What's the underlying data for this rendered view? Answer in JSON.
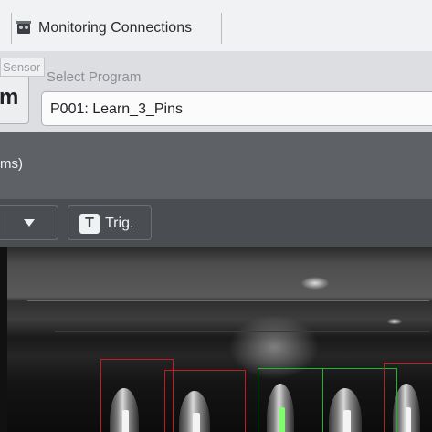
{
  "toolbar_top": {
    "tab_label": "Monitoring Connections",
    "tab_icon": "camera-clapper-icon"
  },
  "program_area": {
    "sensor_tag": "Sensor",
    "mode_button_label": "m",
    "select_label": "Select Program",
    "selected_program": "P001: Learn_3_Pins"
  },
  "info_panel": {
    "text": "ms)"
  },
  "controls": {
    "dropdown_icon": "triangle-down-icon",
    "trigger_icon_letter": "T",
    "trigger_label": "Trig."
  },
  "colors": {
    "fail": "#c21b22",
    "pass": "#1fb52c"
  },
  "camera_view": {
    "regions": [
      {
        "status": "fail"
      },
      {
        "status": "fail"
      },
      {
        "status": "pass"
      },
      {
        "status": "pass"
      },
      {
        "status": "fail"
      }
    ]
  }
}
